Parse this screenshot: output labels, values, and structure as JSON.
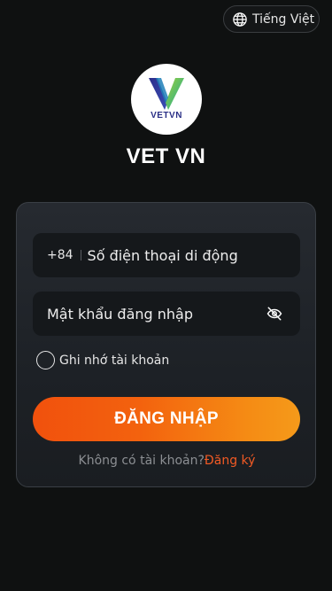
{
  "language": {
    "label": "Tiếng Việt",
    "icon": "globe-icon"
  },
  "logo": {
    "text": "VETVN"
  },
  "app_title": "VET VN",
  "form": {
    "phone": {
      "prefix": "+84",
      "placeholder": "Số điện thoại di động",
      "value": ""
    },
    "password": {
      "placeholder": "Mật khẩu đăng nhập",
      "value": "",
      "toggle_icon": "eye-off-icon"
    },
    "remember_label": "Ghi nhớ tài khoản",
    "login_label": "ĐĂNG NHẬP",
    "no_account_text": "Không có tài khoản?",
    "signup_label": "Đăng ký"
  },
  "colors": {
    "background": "#0f1111",
    "accent": "#f15a24",
    "button_gradient_start": "#f1510d",
    "button_gradient_end": "#f59a1a"
  }
}
